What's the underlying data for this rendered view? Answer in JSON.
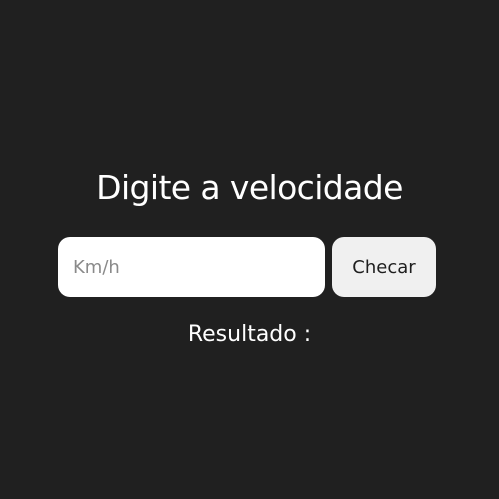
{
  "page": {
    "title": "Digite a velocidade",
    "background_color": "#202020"
  },
  "form": {
    "speed_input": {
      "value": "",
      "placeholder": "Km/h"
    },
    "check_button_label": "Checar"
  },
  "result": {
    "label": "Resultado :"
  }
}
